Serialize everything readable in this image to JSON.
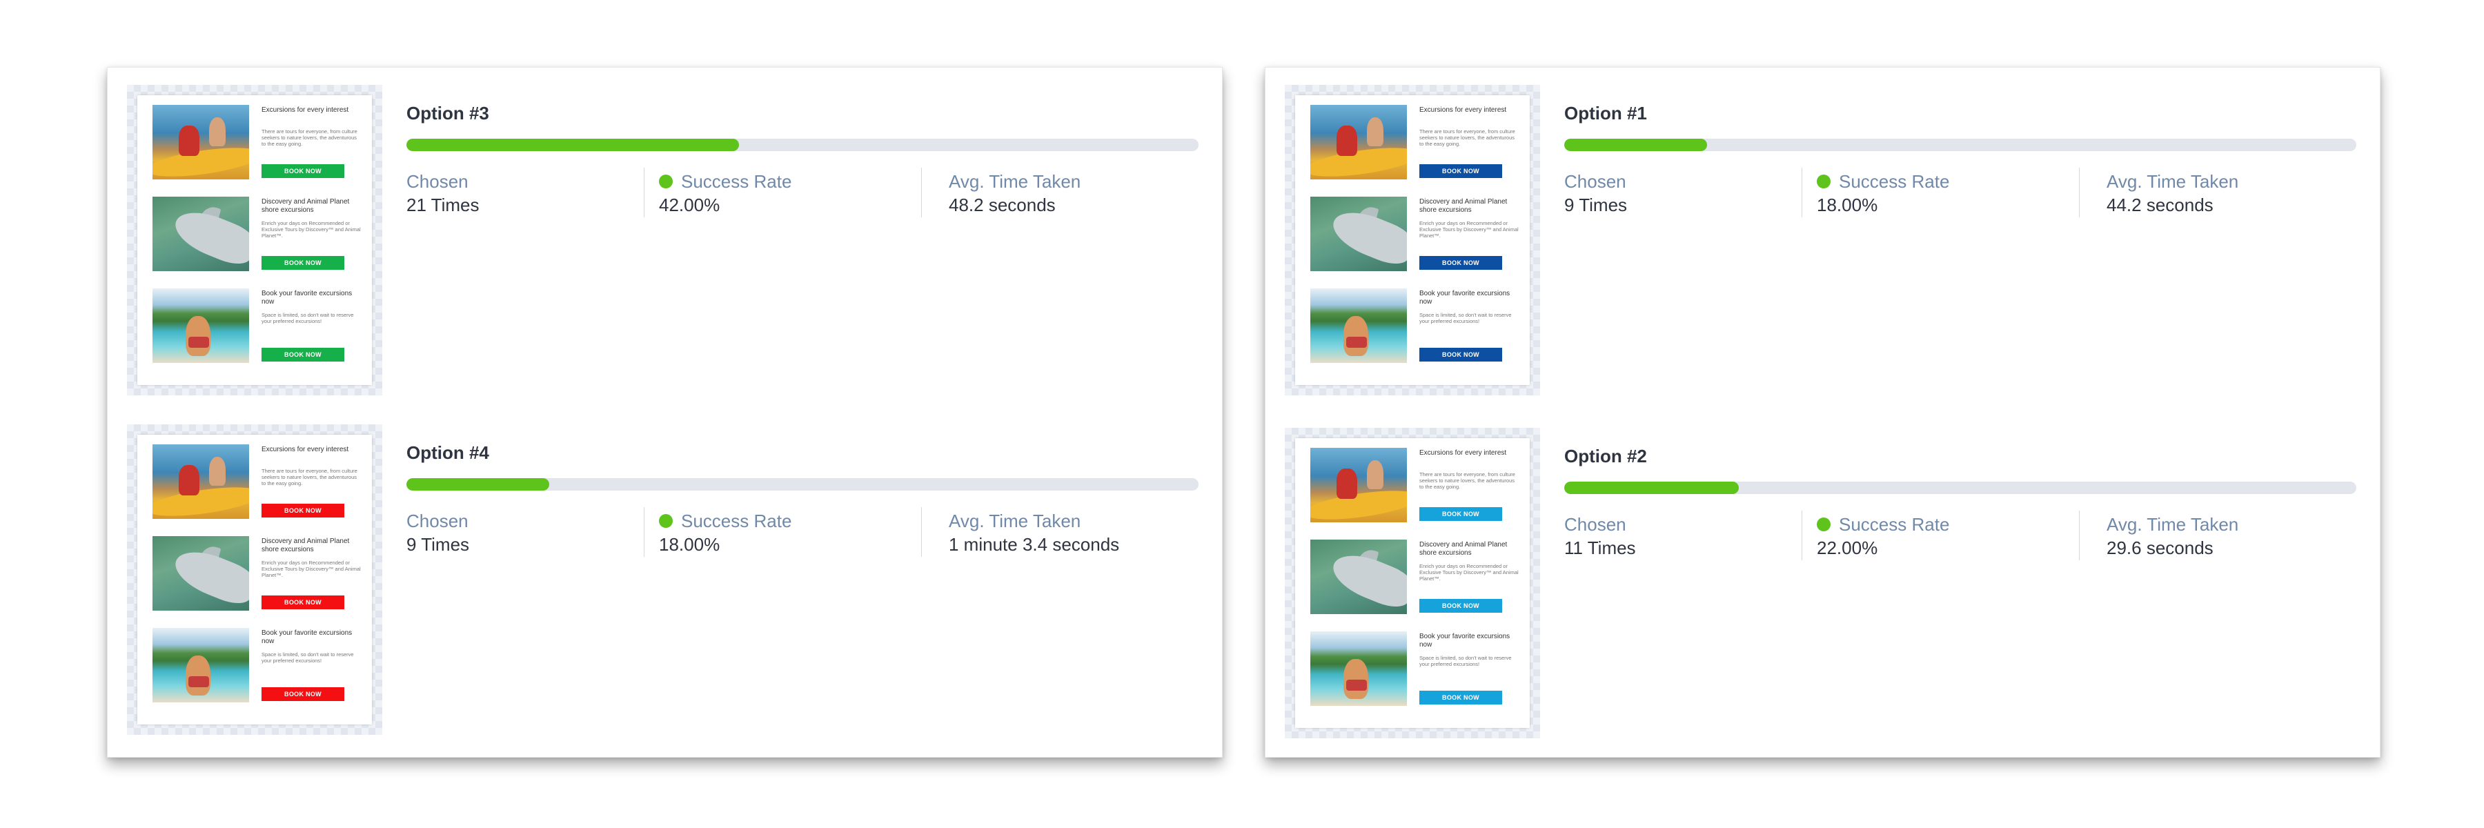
{
  "email": {
    "rows": [
      {
        "heading": "Excursions for every interest",
        "desc": "There are tours for everyone, from culture seekers to nature lovers, the adventurous to the easy going.",
        "photo": "kayak"
      },
      {
        "heading": "Discovery and Animal Planet shore excursions",
        "desc": "Enrich your days on Recommended or Exclusive Tours by Discovery™ and Animal Planet™.",
        "photo": "dolphin"
      },
      {
        "heading": "Book your favorite excursions now",
        "desc": "Space is limited, so don't wait to reserve your preferred excursions!",
        "photo": "beach"
      }
    ],
    "button_label": "BOOK NOW"
  },
  "labels": {
    "chosen": "Chosen",
    "success_rate": "Success Rate",
    "avg_time": "Avg. Time Taken"
  },
  "colors": {
    "progress": "#5ec31b",
    "success_dot": "#5ec31b"
  },
  "panels": {
    "left": {
      "options": [
        {
          "title": "Option #3",
          "button_color": "#16b04a",
          "success_fraction": 0.42,
          "chosen": "21 Times",
          "success_rate": "42.00%",
          "avg_time": "48.2 seconds"
        },
        {
          "title": "Option #4",
          "button_color": "#f40f12",
          "success_fraction": 0.18,
          "chosen": "9 Times",
          "success_rate": "18.00%",
          "avg_time": "1 minute 3.4 seconds"
        }
      ]
    },
    "right": {
      "options": [
        {
          "title": "Option #1",
          "button_color": "#0d4fa2",
          "success_fraction": 0.18,
          "chosen": "9 Times",
          "success_rate": "18.00%",
          "avg_time": "44.2 seconds"
        },
        {
          "title": "Option #2",
          "button_color": "#16a3db",
          "success_fraction": 0.22,
          "chosen": "11 Times",
          "success_rate": "22.00%",
          "avg_time": "29.6 seconds"
        }
      ]
    }
  }
}
